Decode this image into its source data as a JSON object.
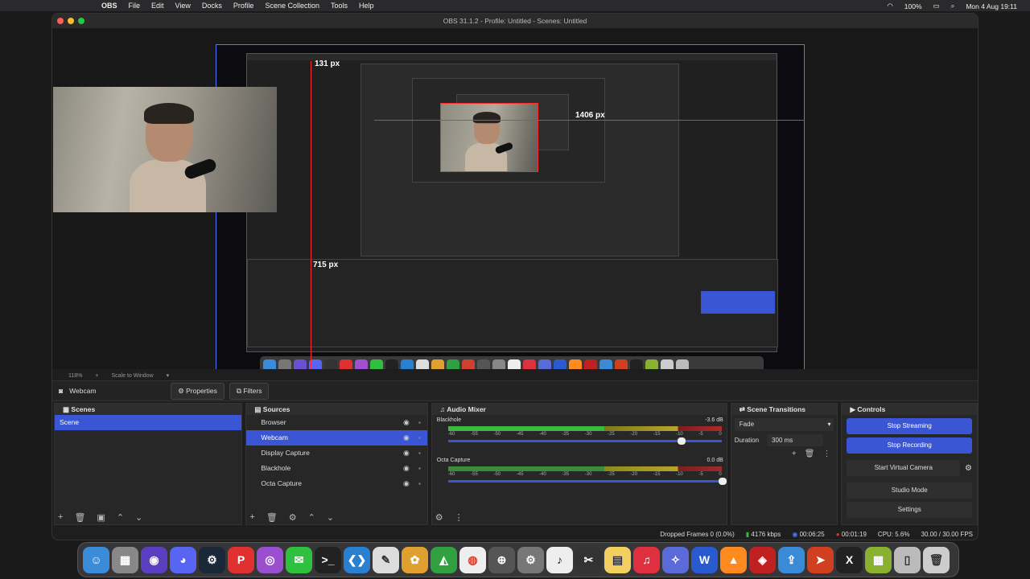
{
  "menubar": {
    "app_name": "OBS",
    "items": [
      "File",
      "Edit",
      "View",
      "Docks",
      "Profile",
      "Scene Collection",
      "Tools",
      "Help"
    ],
    "battery": "100%",
    "clock": "Mon 4 Aug  19:11"
  },
  "window": {
    "title": "OBS 31.1.2 - Profile: Untitled - Scenes: Untitled"
  },
  "preview": {
    "measure_top": "131 px",
    "measure_right": "1406 px",
    "measure_bottom": "715 px"
  },
  "zoom": {
    "level": "118%",
    "mode": "Scale to Window"
  },
  "source_bar": {
    "source_name": "Webcam",
    "properties_label": "Properties",
    "filters_label": "Filters"
  },
  "scenes": {
    "title": "Scenes",
    "items": [
      "Scene"
    ]
  },
  "sources": {
    "title": "Sources",
    "items": [
      {
        "label": "Browser",
        "icon": "globe-icon"
      },
      {
        "label": "Webcam",
        "icon": "camera-icon"
      },
      {
        "label": "Display Capture",
        "icon": "monitor-icon"
      },
      {
        "label": "Blackhole",
        "icon": "mic-icon"
      },
      {
        "label": "Octa Capture",
        "icon": "mic-icon"
      }
    ]
  },
  "mixer": {
    "title": "Audio Mixer",
    "scale": [
      "-60",
      "-55",
      "-50",
      "-45",
      "-40",
      "-35",
      "-30",
      "-25",
      "-20",
      "-15",
      "-10",
      "-5",
      "0"
    ],
    "channels": [
      {
        "name": "Blackhole",
        "db": "-3.6 dB",
        "volume": 0.84
      },
      {
        "name": "Octa Capture",
        "db": "0.0 dB",
        "volume": 0.99
      }
    ]
  },
  "transitions": {
    "title": "Scene Transitions",
    "type": "Fade",
    "duration_label": "Duration",
    "duration_value": "300 ms"
  },
  "controls": {
    "title": "Controls",
    "stop_streaming": "Stop Streaming",
    "stop_recording": "Stop Recording",
    "virtual_camera": "Start Virtual Camera",
    "studio_mode": "Studio Mode",
    "settings": "Settings"
  },
  "status": {
    "dropped": "Dropped Frames 0 (0.0%)",
    "bitrate": "4176 kbps",
    "stream_time": "00:06:25",
    "rec_time": "00:01:19",
    "cpu": "CPU: 5.6%",
    "fps": "30.00 / 30.00 FPS"
  },
  "colors": {
    "accent": "#3a56d4",
    "measure": "#ff2a2a"
  }
}
